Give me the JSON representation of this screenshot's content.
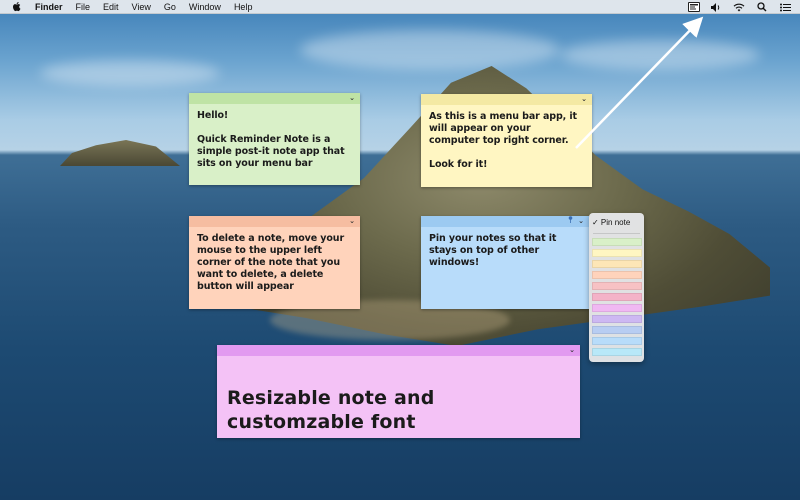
{
  "menubar": {
    "app_name": "Finder",
    "menus": [
      "File",
      "Edit",
      "View",
      "Go",
      "Window",
      "Help"
    ],
    "tray_icons": [
      "quick-reminder-note-icon",
      "volume-icon",
      "wifi-icon",
      "spotlight-search-icon",
      "control-center-icon"
    ]
  },
  "notes": {
    "green": {
      "text": "Hello!\n\nQuick Reminder Note is a simple post-it note app that sits on your menu bar",
      "color": "#d9f0c8"
    },
    "yellow": {
      "text": "As this is a menu bar app, it will appear on your computer top right corner.\n\nLook for it!",
      "color": "#fff6c2"
    },
    "orange": {
      "text": "To delete a note, move your mouse to the upper left corner of the note that you want to delete, a delete button will appear",
      "color": "#ffd3bb"
    },
    "blue": {
      "text": "Pin your notes so that it stays on top of other windows!",
      "color": "#b8dcfa"
    },
    "pink": {
      "text": "Resizable note and customzable font",
      "color": "#f4c2f6"
    }
  },
  "dropdown": {
    "pin_label": "✓ Pin note",
    "swatches": [
      "#d9f0c8",
      "#fff6c2",
      "#fde6b6",
      "#ffd3bb",
      "#f7c2c4",
      "#f4b3c8",
      "#f0b8f2",
      "#cdb8f2",
      "#b8cdf2",
      "#b8dcfa",
      "#b8e8f8"
    ]
  },
  "colors": {
    "arrow": "#ffffff",
    "menubar": "#eceef0"
  }
}
